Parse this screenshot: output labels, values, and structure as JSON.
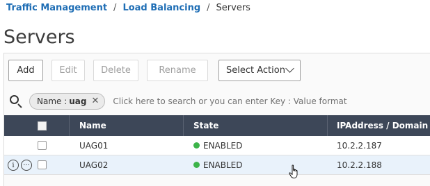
{
  "breadcrumb": {
    "items": [
      "Traffic Management",
      "Load Balancing"
    ],
    "separator": "/",
    "current": "Servers"
  },
  "page": {
    "title": "Servers"
  },
  "toolbar": {
    "add": "Add",
    "edit": "Edit",
    "delete": "Delete",
    "rename": "Rename",
    "select_action": "Select Action"
  },
  "search": {
    "chip_key": "Name :",
    "chip_value": "uag",
    "chip_close": "✕",
    "placeholder": "Click here to search or you can enter Key : Value format"
  },
  "table": {
    "columns": [
      "Name",
      "State",
      "IPAddress / Domain"
    ],
    "rows": [
      {
        "name": "UAG01",
        "state": "ENABLED",
        "ip": "10.2.2.187"
      },
      {
        "name": "UAG02",
        "state": "ENABLED",
        "ip": "10.2.2.188"
      }
    ],
    "row_icons": {
      "info": "i",
      "more": "···"
    }
  },
  "colors": {
    "link": "#1f6eb5",
    "header_bg": "#3d4758",
    "enabled_green": "#3cb44a",
    "hover_row": "#e9f2fb"
  },
  "icons": [
    "search-icon",
    "close-icon",
    "chevron-down-icon",
    "info-icon",
    "more-icon",
    "hand-cursor-icon"
  ]
}
